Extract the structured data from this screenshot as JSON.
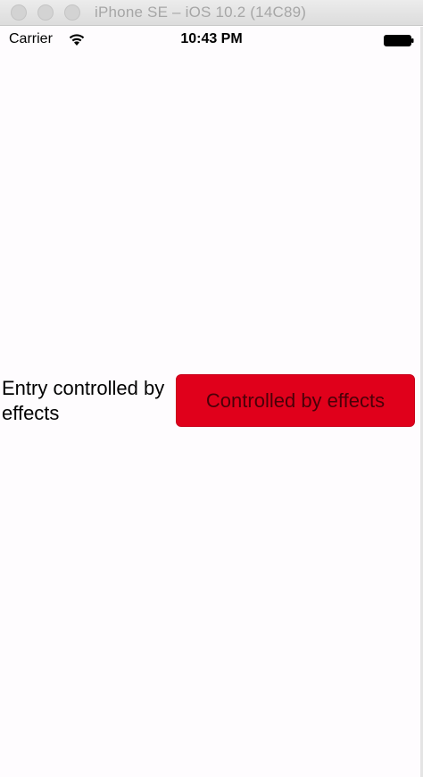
{
  "window": {
    "title": "iPhone SE – iOS 10.2 (14C89)"
  },
  "status_bar": {
    "carrier": "Carrier",
    "wifi_icon": "wifi-icon",
    "time": "10:43 PM",
    "battery_icon": "battery-icon"
  },
  "content": {
    "entry_label": "Entry controlled by effects",
    "button_label": "Controlled by effects",
    "button_color": "#e0001b",
    "button_text_color": "#4a0008"
  }
}
